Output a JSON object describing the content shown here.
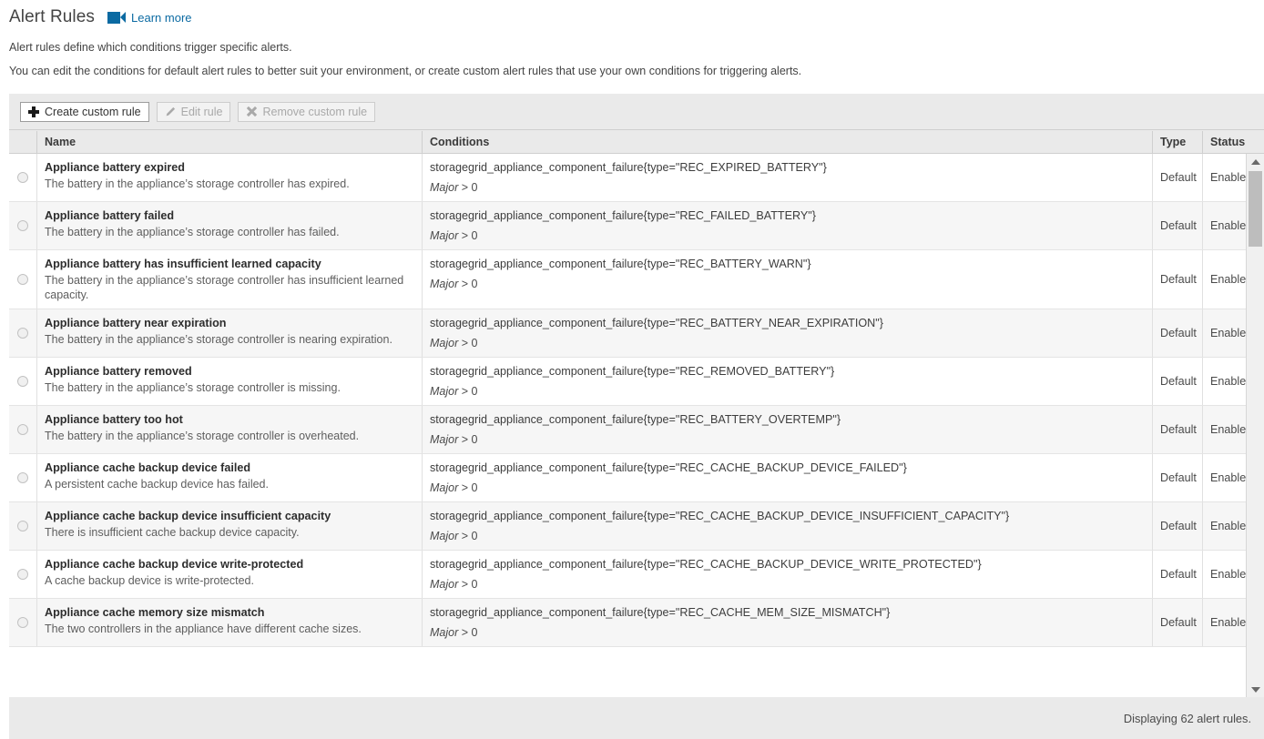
{
  "header": {
    "title": "Alert Rules",
    "learn_more": "Learn more",
    "learn_more_icon": "video-icon",
    "description_line_1": "Alert rules define which conditions trigger specific alerts.",
    "description_line_2": "You can edit the conditions for default alert rules to better suit your environment, or create custom alert rules that use your own conditions for triggering alerts."
  },
  "toolbar": {
    "create_label": "Create custom rule",
    "create_icon": "plus-icon",
    "edit_label": "Edit rule",
    "edit_icon": "pencil-icon",
    "remove_label": "Remove custom rule",
    "remove_icon": "x-icon"
  },
  "table": {
    "columns": [
      "Name",
      "Conditions",
      "Type",
      "Status"
    ],
    "rows": [
      {
        "name": "Appliance battery expired",
        "description": "The battery in the appliance’s storage controller has expired.",
        "condition": "storagegrid_appliance_component_failure{type=\"REC_EXPIRED_BATTERY\"}",
        "severity": "Major",
        "comparison": "> 0",
        "type": "Default",
        "status": "Enabled"
      },
      {
        "name": "Appliance battery failed",
        "description": "The battery in the appliance’s storage controller has failed.",
        "condition": "storagegrid_appliance_component_failure{type=\"REC_FAILED_BATTERY\"}",
        "severity": "Major",
        "comparison": "> 0",
        "type": "Default",
        "status": "Enabled"
      },
      {
        "name": "Appliance battery has insufficient learned capacity",
        "description": "The battery in the appliance’s storage controller has insufficient learned capacity.",
        "condition": "storagegrid_appliance_component_failure{type=\"REC_BATTERY_WARN\"}",
        "severity": "Major",
        "comparison": "> 0",
        "type": "Default",
        "status": "Enabled"
      },
      {
        "name": "Appliance battery near expiration",
        "description": "The battery in the appliance’s storage controller is nearing expiration.",
        "condition": "storagegrid_appliance_component_failure{type=\"REC_BATTERY_NEAR_EXPIRATION\"}",
        "severity": "Major",
        "comparison": "> 0",
        "type": "Default",
        "status": "Enabled"
      },
      {
        "name": "Appliance battery removed",
        "description": "The battery in the appliance’s storage controller is missing.",
        "condition": "storagegrid_appliance_component_failure{type=\"REC_REMOVED_BATTERY\"}",
        "severity": "Major",
        "comparison": "> 0",
        "type": "Default",
        "status": "Enabled"
      },
      {
        "name": "Appliance battery too hot",
        "description": "The battery in the appliance’s storage controller is overheated.",
        "condition": "storagegrid_appliance_component_failure{type=\"REC_BATTERY_OVERTEMP\"}",
        "severity": "Major",
        "comparison": "> 0",
        "type": "Default",
        "status": "Enabled"
      },
      {
        "name": "Appliance cache backup device failed",
        "description": "A persistent cache backup device has failed.",
        "condition": "storagegrid_appliance_component_failure{type=\"REC_CACHE_BACKUP_DEVICE_FAILED\"}",
        "severity": "Major",
        "comparison": "> 0",
        "type": "Default",
        "status": "Enabled"
      },
      {
        "name": "Appliance cache backup device insufficient capacity",
        "description": "There is insufficient cache backup device capacity.",
        "condition": "storagegrid_appliance_component_failure{type=\"REC_CACHE_BACKUP_DEVICE_INSUFFICIENT_CAPACITY\"}",
        "severity": "Major",
        "comparison": "> 0",
        "type": "Default",
        "status": "Enabled"
      },
      {
        "name": "Appliance cache backup device write-protected",
        "description": "A cache backup device is write-protected.",
        "condition": "storagegrid_appliance_component_failure{type=\"REC_CACHE_BACKUP_DEVICE_WRITE_PROTECTED\"}",
        "severity": "Major",
        "comparison": "> 0",
        "type": "Default",
        "status": "Enabled"
      },
      {
        "name": "Appliance cache memory size mismatch",
        "description": "The two controllers in the appliance have different cache sizes.",
        "condition": "storagegrid_appliance_component_failure{type=\"REC_CACHE_MEM_SIZE_MISMATCH\"}",
        "severity": "Major",
        "comparison": "> 0",
        "type": "Default",
        "status": "Enabled"
      }
    ]
  },
  "footer": {
    "status_text": "Displaying 62 alert rules."
  },
  "colors": {
    "link": "#0b6aa2",
    "panel_bg": "#eaeaea",
    "row_alt_bg": "#f6f6f6",
    "border": "#cfcfcf"
  }
}
